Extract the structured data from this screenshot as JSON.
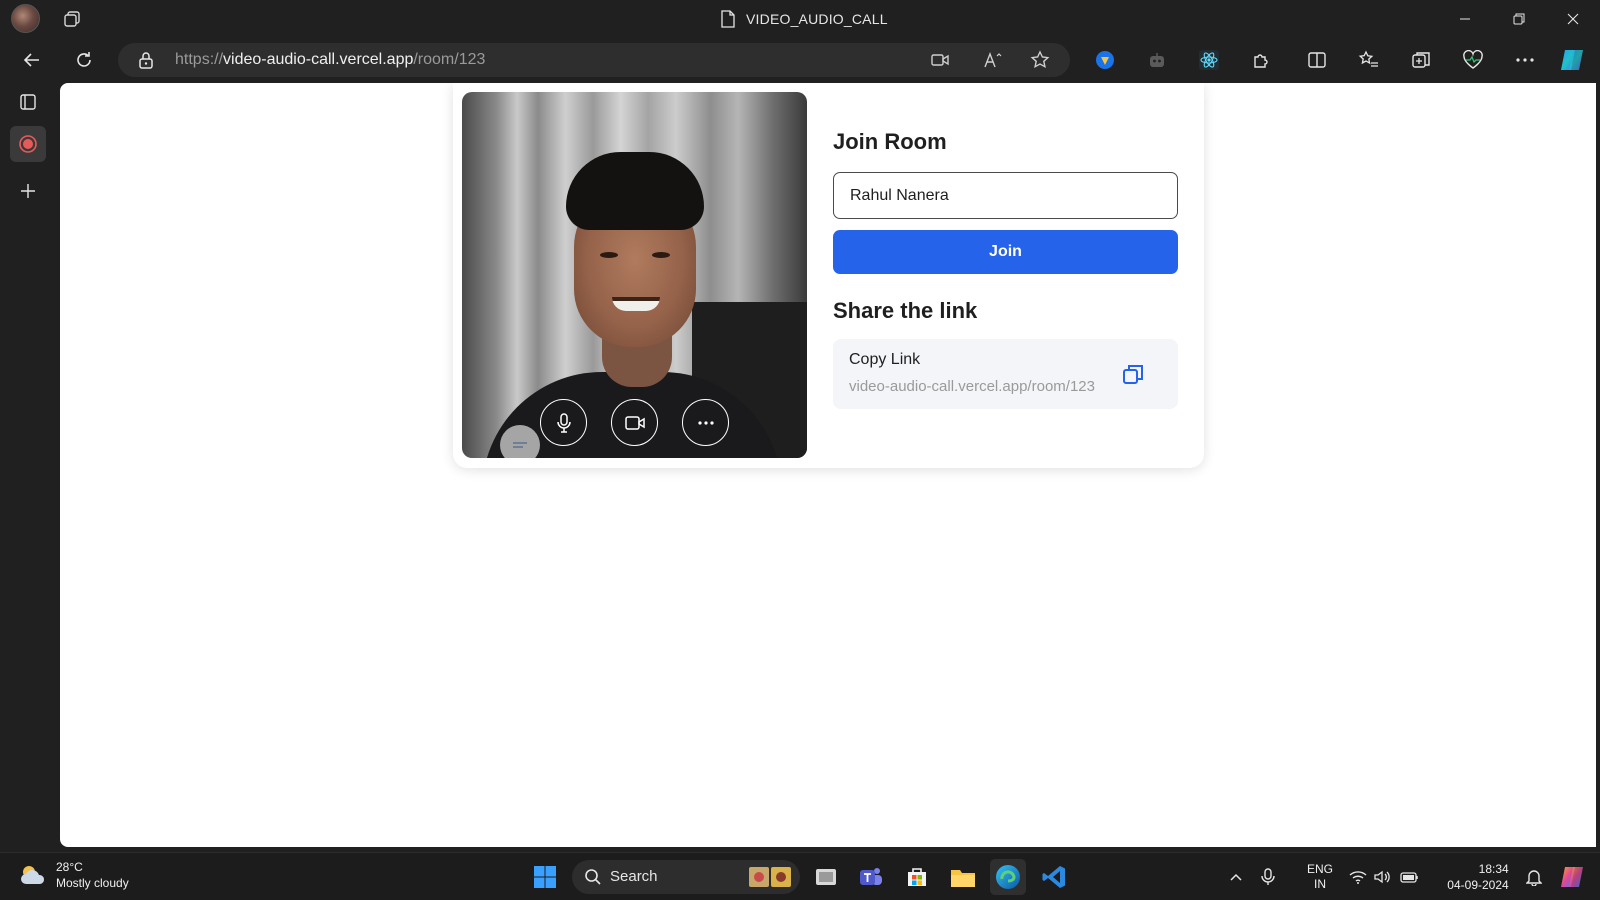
{
  "window": {
    "title": "VIDEO_AUDIO_CALL"
  },
  "address_bar": {
    "url_prefix": "https://",
    "url_host": "video-audio-call.vercel.app",
    "url_path": "/room/123"
  },
  "page": {
    "join_heading": "Join Room",
    "name_value": "Rahul Nanera",
    "join_button": "Join",
    "share_heading": "Share the link",
    "copy_label": "Copy Link",
    "copy_url": "video-audio-call.vercel.app/room/123",
    "accent_color": "#2563eb"
  },
  "video_controls": [
    "mic-icon",
    "camera-icon",
    "more-icon"
  ],
  "taskbar": {
    "weather_temp": "28°C",
    "weather_desc": "Mostly cloudy",
    "search_label": "Search",
    "lang_top": "ENG",
    "lang_bottom": "IN",
    "time": "18:34",
    "date": "04-09-2024"
  }
}
